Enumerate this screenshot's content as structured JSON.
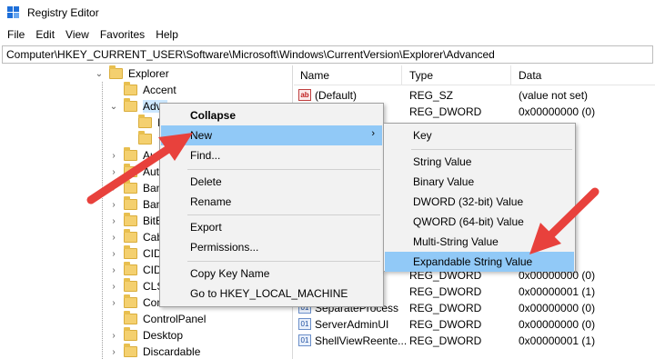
{
  "window": {
    "title": "Registry Editor"
  },
  "menubar": [
    "File",
    "Edit",
    "View",
    "Favorites",
    "Help"
  ],
  "address": "Computer\\HKEY_CURRENT_USER\\Software\\Microsoft\\Windows\\CurrentVersion\\Explorer\\Advanced",
  "tree": {
    "explorer": "Explorer",
    "accent": "Accent",
    "advanced": "Adva",
    "sub1": "I",
    "sub2": "",
    "items": [
      "Au",
      "Aut",
      "Ban",
      "Ban",
      "BitB",
      "Cab",
      "CID",
      "CID",
      "CLS",
      "Com",
      "ControlPanel",
      "Desktop",
      "Discardable"
    ]
  },
  "values": {
    "headers": {
      "name": "Name",
      "type": "Type",
      "data": "Data"
    },
    "rows": [
      {
        "name": "(Default)",
        "type": "REG_SZ",
        "data": "(value not set)"
      },
      {
        "name": "ct",
        "type": "REG_DWORD",
        "data": "0x00000000 (0)"
      },
      {
        "name": "",
        "type": "",
        "data": "(0)"
      },
      {
        "name": "",
        "type": "",
        "data": "(0)"
      },
      {
        "name": "",
        "type": "",
        "data": "(2)"
      },
      {
        "name": "",
        "type": "",
        "data": "(0)"
      },
      {
        "name": "",
        "type": "",
        "data": "(0)"
      },
      {
        "name": "",
        "type": "",
        "data": "(0)"
      },
      {
        "name": "",
        "type": "",
        "data": "(1)"
      },
      {
        "name": "",
        "type": "",
        "data": "(1)"
      },
      {
        "name": "",
        "type": "",
        "data": "(0)"
      },
      {
        "name": "de",
        "type": "REG_DWORD",
        "data": "0x00000000 (0)"
      },
      {
        "name": "",
        "type": "REG_DWORD",
        "data": "0x00000001 (1)"
      },
      {
        "name": "SeparateProcess",
        "type": "REG_DWORD",
        "data": "0x00000000 (0)"
      },
      {
        "name": "ServerAdminUI",
        "type": "REG_DWORD",
        "data": "0x00000000 (0)"
      },
      {
        "name": "ShellViewReente...",
        "type": "REG_DWORD",
        "data": "0x00000001 (1)"
      }
    ]
  },
  "context_menu": {
    "collapse": "Collapse",
    "new": "New",
    "find": "Find...",
    "delete": "Delete",
    "rename": "Rename",
    "export": "Export",
    "permissions": "Permissions...",
    "copy_key_name": "Copy Key Name",
    "goto": "Go to HKEY_LOCAL_MACHINE"
  },
  "submenu": {
    "key": "Key",
    "string": "String Value",
    "binary": "Binary Value",
    "dword": "DWORD (32-bit) Value",
    "qword": "QWORD (64-bit) Value",
    "multi": "Multi-String Value",
    "expandable": "Expandable String Value"
  },
  "colors": {
    "highlight": "#91c9f7",
    "arrow": "#e8413c",
    "selection": "#cde8ff"
  }
}
